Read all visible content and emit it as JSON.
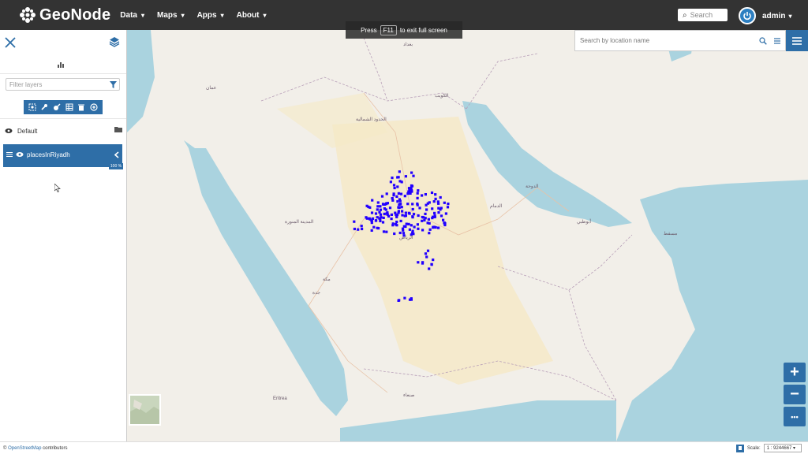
{
  "brand": {
    "name": "GeoNode"
  },
  "nav": {
    "items": [
      {
        "label": "Data"
      },
      {
        "label": "Maps"
      },
      {
        "label": "Apps"
      },
      {
        "label": "About"
      }
    ]
  },
  "header_search": {
    "placeholder": "Search"
  },
  "user": {
    "name": "admin"
  },
  "sidebar": {
    "filter_placeholder": "Filter layers",
    "toolbar_icons": [
      "zoom-to-layer-icon",
      "settings-icon",
      "style-icon",
      "attribute-table-icon",
      "delete-icon",
      "add-layer-icon"
    ],
    "group": {
      "label": "Default"
    },
    "layer": {
      "label": "placesInRiyadh",
      "opacity": "100 %"
    }
  },
  "fullscreen_notice": {
    "prefix": "Press",
    "key": "F11",
    "suffix": "to exit full screen"
  },
  "location_search": {
    "placeholder": "Search by location name"
  },
  "zoom": {
    "in": "+",
    "out": "−",
    "more": "•••"
  },
  "attribution": {
    "prefix": "© ",
    "link": "OpenStreetMap",
    "suffix": " contributors"
  },
  "scale": {
    "label": "Scale:",
    "value": "1 : 9244667"
  },
  "colors": {
    "accent": "#2e6ea7",
    "topbar": "#333333",
    "points": "#2200ff",
    "sea": "#aad3df",
    "desert": "#f5e9c6"
  },
  "map_labels": [
    {
      "text": "الرياض"
    },
    {
      "text": "مكة"
    },
    {
      "text": "جدة"
    },
    {
      "text": "الكويت"
    },
    {
      "text": "الدوحة"
    },
    {
      "text": "أبوظبي"
    },
    {
      "text": "مسقط"
    },
    {
      "text": "صنعاء"
    },
    {
      "text": "المدينة المنورة"
    },
    {
      "text": "الدمام"
    },
    {
      "text": "الحدود الشمالية"
    },
    {
      "text": "عمان"
    },
    {
      "text": "بغداد"
    },
    {
      "text": "Eritrea"
    }
  ]
}
